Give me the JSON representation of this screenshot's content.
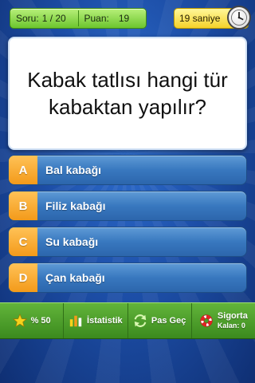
{
  "header": {
    "question_label": "Soru:",
    "question_count": "1 / 20",
    "points_label": "Puan:",
    "points_value": "19",
    "timer_text": "19 saniye",
    "timer_icon": "clock-icon"
  },
  "question": {
    "text": "Kabak tatlısı hangi tür kabaktan yapılır?"
  },
  "answers": [
    {
      "letter": "A",
      "label": "Bal kabağı"
    },
    {
      "letter": "B",
      "label": "Filiz kabağı"
    },
    {
      "letter": "C",
      "label": "Su kabağı"
    },
    {
      "letter": "D",
      "label": "Çan kabağı"
    }
  ],
  "toolbar": {
    "fifty_label": "% 50",
    "stats_label": "İstatistik",
    "pass_label": "Pas Geç",
    "insurance_label": "Sigorta",
    "insurance_remaining": "Kalan: 0"
  },
  "colors": {
    "answer_blue": "#3878bf",
    "letter_orange": "#f39a1a",
    "toolbar_green": "#4c9d2b",
    "score_green": "#8fd94f",
    "timer_yellow": "#f7e04a"
  }
}
